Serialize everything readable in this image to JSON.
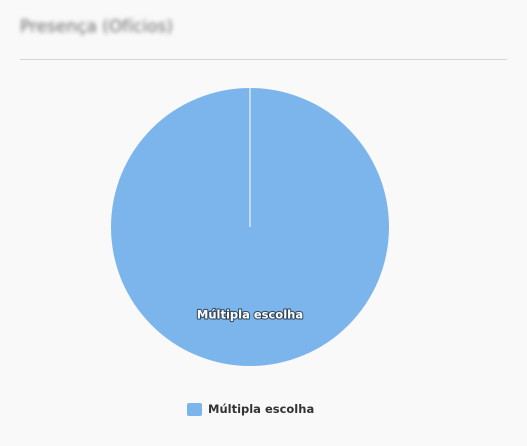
{
  "panel": {
    "title": "Presença (Ofícios)"
  },
  "chart_data": {
    "type": "pie",
    "title": "",
    "slices": [
      {
        "label": "Múltipla escolha",
        "value": 100,
        "color": "#7cb5ec"
      }
    ],
    "legend_position": "bottom-center",
    "slice_border_color": "#ffffff"
  }
}
